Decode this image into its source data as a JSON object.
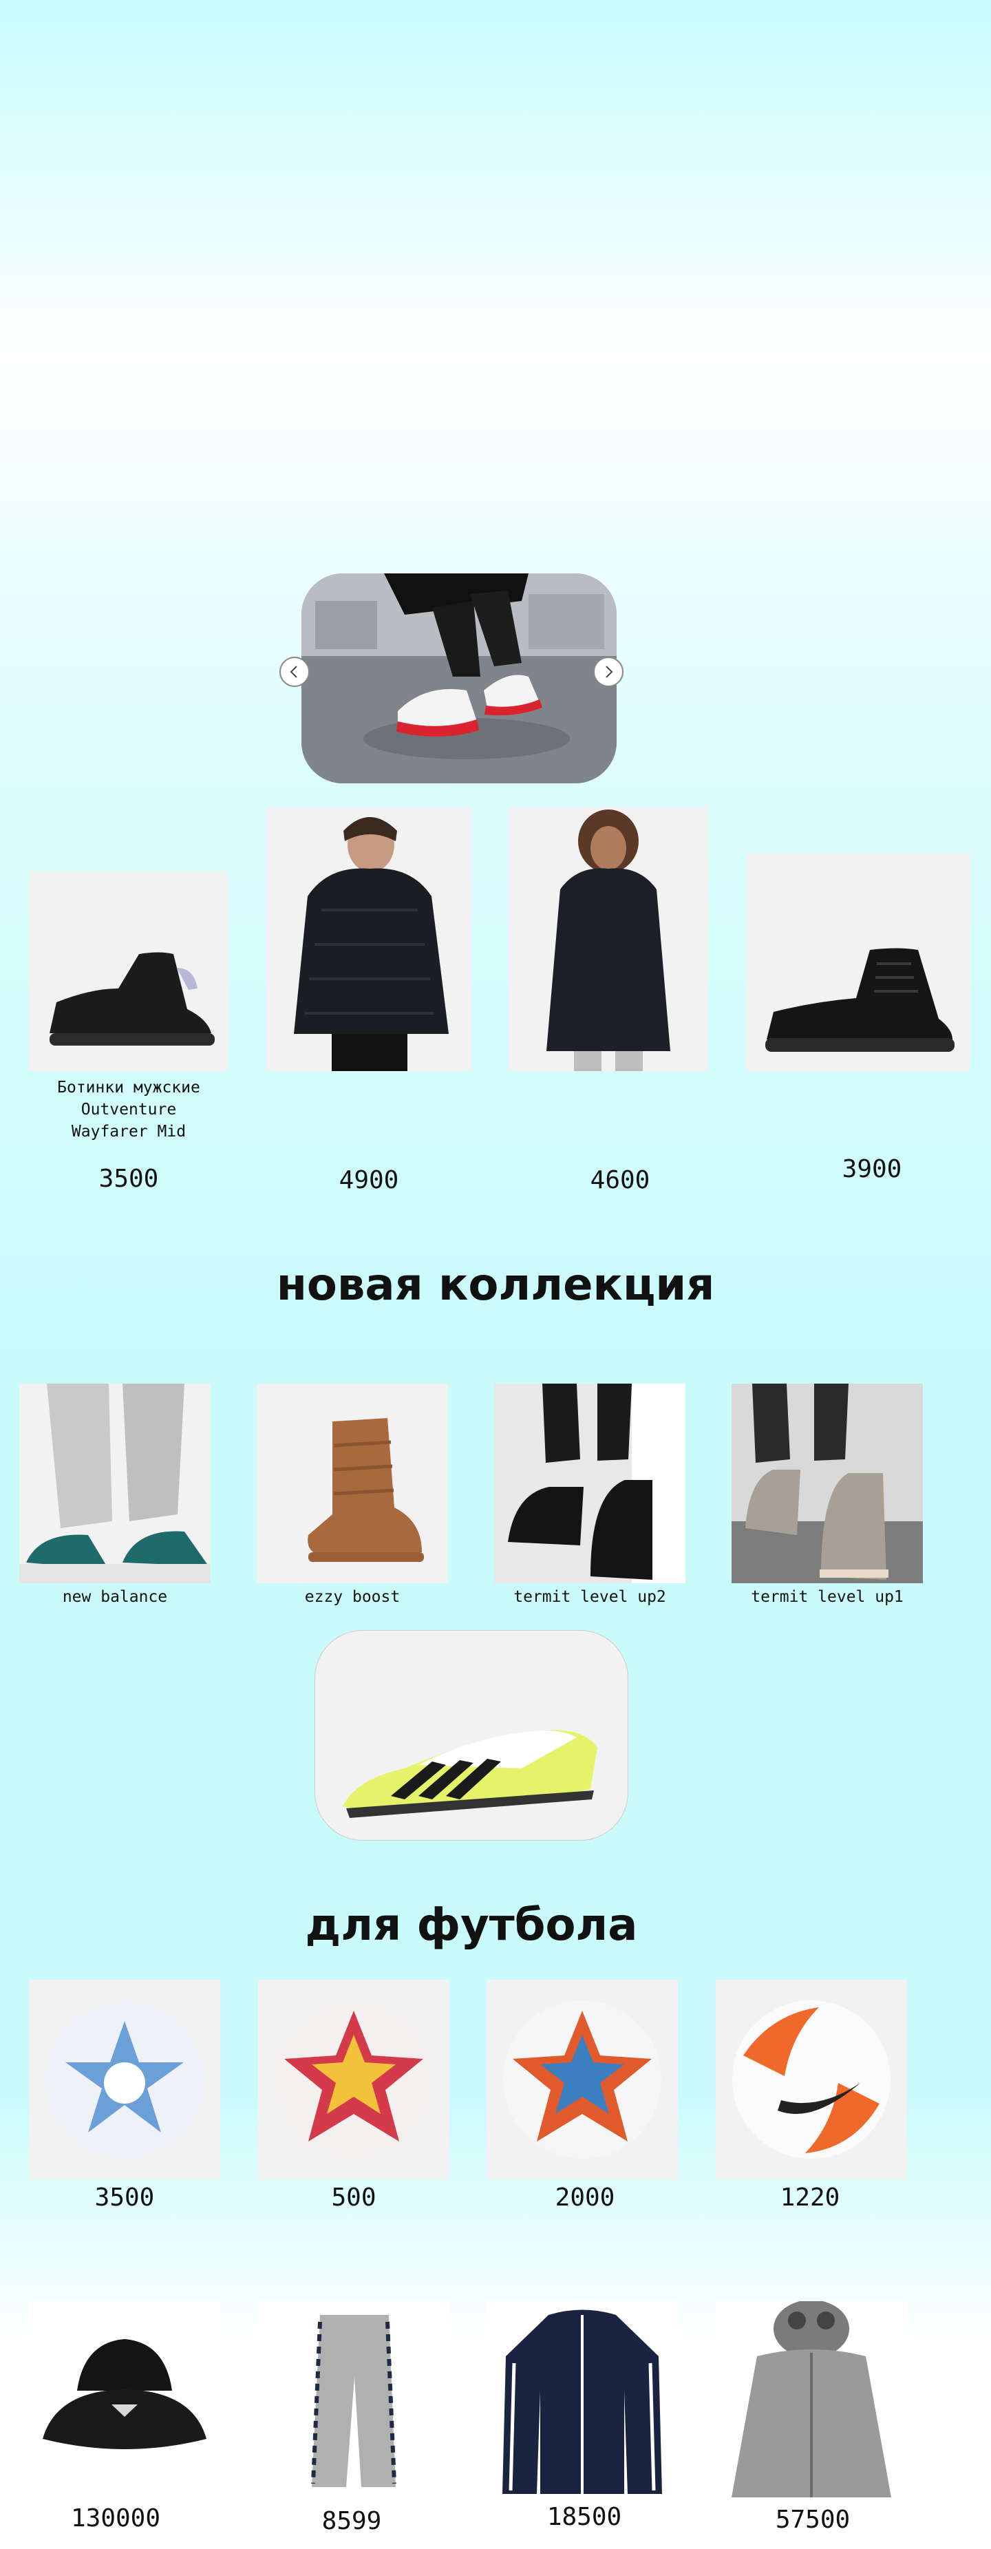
{
  "slider": {
    "prev_icon": "chevron-left-icon",
    "next_icon": "chevron-right-icon"
  },
  "featured": [
    {
      "name": "Ботинки мужские Outventure Wayfarer Mid",
      "price": "3500"
    },
    {
      "name": "",
      "price": "4900"
    },
    {
      "name": "",
      "price": "4600"
    },
    {
      "name": "",
      "price": "3900"
    }
  ],
  "new_collection": {
    "title": "новая коллекция",
    "items": [
      {
        "name": "new balance"
      },
      {
        "name": "ezzy boost"
      },
      {
        "name": "termit level up2"
      },
      {
        "name": "termit level up1"
      }
    ]
  },
  "football": {
    "title": "для футбола",
    "items": [
      {
        "price": "3500"
      },
      {
        "price": "500"
      },
      {
        "price": "2000"
      },
      {
        "price": "1220"
      }
    ]
  },
  "apparel": {
    "items": [
      {
        "price": "130000"
      },
      {
        "price": "8599"
      },
      {
        "price": "18500"
      },
      {
        "price": "57500"
      }
    ]
  }
}
